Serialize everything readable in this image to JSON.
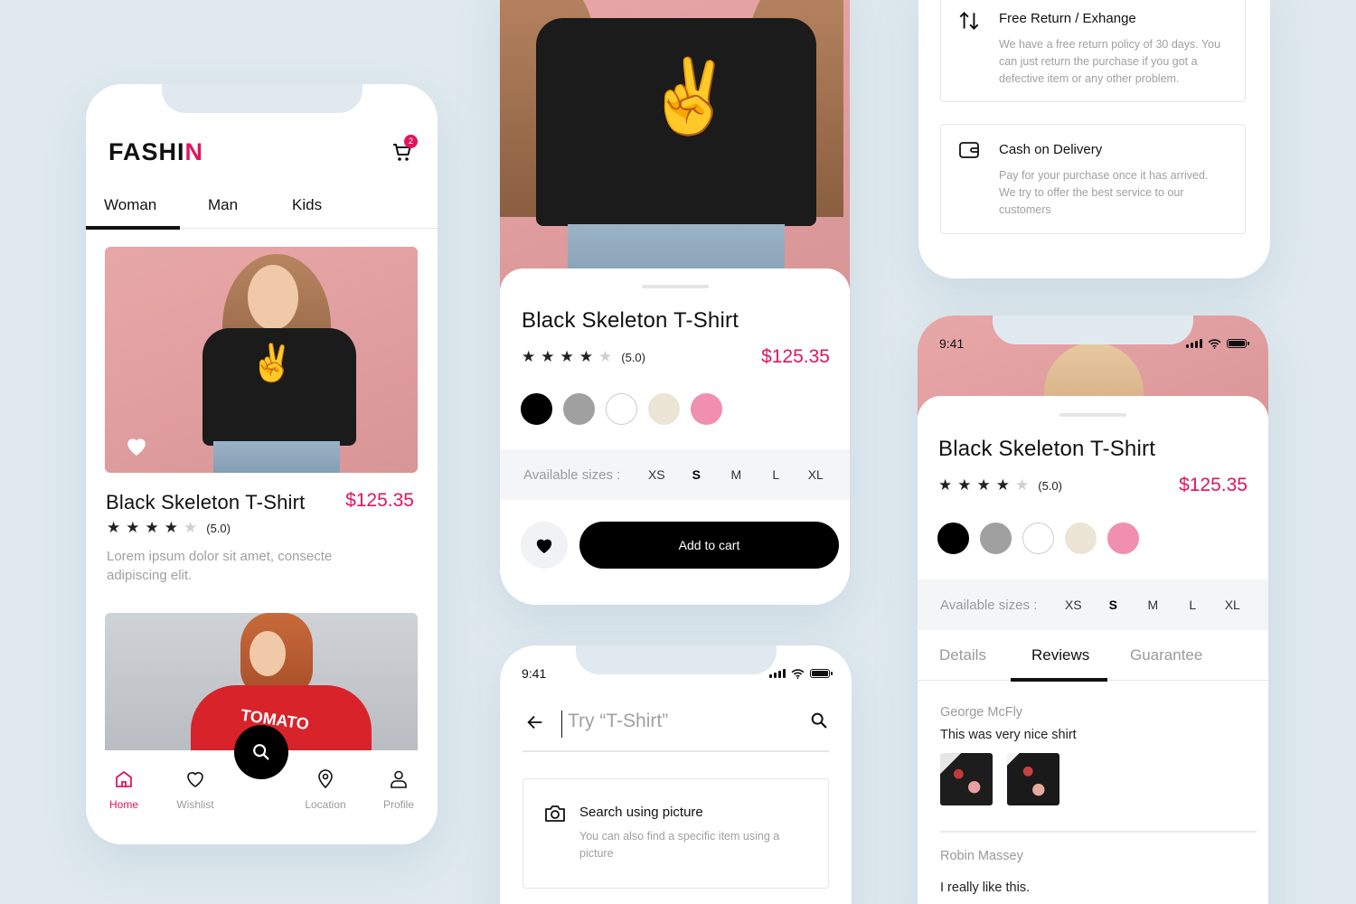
{
  "colors": {
    "accent": "#e0145f",
    "background": "#dfe9ef",
    "black": "#000000"
  },
  "home": {
    "logo": "FASHI",
    "logo_tail": "N",
    "cart_count": "2",
    "tabs": [
      "Woman",
      "Man",
      "Kids"
    ],
    "product": {
      "name": "Black Skeleton T-Shirt",
      "price": "$125.35",
      "rating": "(5.0)",
      "stars_filled": 4,
      "description": "Lorem ipsum dolor sit amet, consecte adipiscing elit."
    },
    "second_product_print": "TOMATO",
    "nav": [
      {
        "label": "Home",
        "icon": "home-icon",
        "active": true
      },
      {
        "label": "Wishlist",
        "icon": "heart-icon",
        "active": false
      },
      {
        "label": "Location",
        "icon": "location-pin-icon",
        "active": false
      },
      {
        "label": "Profile",
        "icon": "user-icon",
        "active": false
      }
    ]
  },
  "detail": {
    "name": "Black Skeleton T-Shirt",
    "rating": "(5.0)",
    "stars_filled": 4,
    "price": "$125.35",
    "colors": [
      "#000000",
      "#a0a0a0",
      "#ffffff",
      "#ece4d4",
      "#f08fb0"
    ],
    "sizes_label": "Available sizes :",
    "sizes": [
      "XS",
      "S",
      "M",
      "L",
      "XL"
    ],
    "selected_size": "S",
    "add_to_cart": "Add to cart"
  },
  "search": {
    "time": "9:41",
    "placeholder": "Try “T-Shirt”",
    "picture_title": "Search using picture",
    "picture_desc": "You can also find a specific item using a picture"
  },
  "guarantee": {
    "return_title": "Free Return / Exhange",
    "return_desc": "We have a free return policy of 30 days. You can just return the purchase if you got a defective item or any other problem.",
    "cod_title": "Cash on Delivery",
    "cod_desc": "Pay for your purchase once it has arrived. We try to offer the best service to our customers"
  },
  "reviews": {
    "time": "9:41",
    "name": "Black Skeleton T-Shirt",
    "rating": "(5.0)",
    "stars_filled": 4,
    "price": "$125.35",
    "colors": [
      "#000000",
      "#a0a0a0",
      "#ffffff",
      "#ece4d4",
      "#f08fb0"
    ],
    "sizes_label": "Available sizes :",
    "sizes": [
      "XS",
      "S",
      "M",
      "L",
      "XL"
    ],
    "selected_size": "S",
    "tabs": [
      "Details",
      "Reviews",
      "Guarantee"
    ],
    "active_tab": "Reviews",
    "items": [
      {
        "author": "George McFly",
        "text": "This was very nice shirt"
      },
      {
        "author": "Robin Massey",
        "text": "I really like this."
      }
    ]
  }
}
